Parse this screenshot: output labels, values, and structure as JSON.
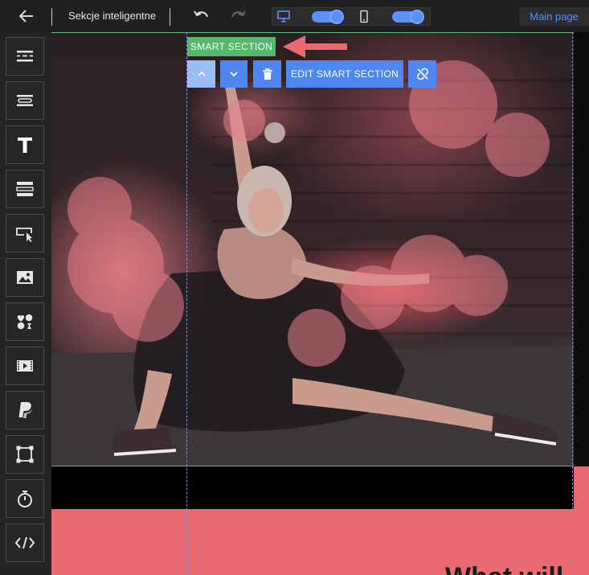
{
  "header": {
    "title": "Sekcje inteligentne",
    "main_page_label": "Main page",
    "icons": [
      "back-arrow-icon",
      "undo-icon",
      "redo-icon",
      "desktop-icon",
      "mobile-icon"
    ]
  },
  "sidebar": {
    "items": [
      {
        "name": "section-layout-icon"
      },
      {
        "name": "smart-section-icon"
      },
      {
        "name": "text-icon",
        "glyph": "T"
      },
      {
        "name": "rows-icon"
      },
      {
        "name": "button-cursor-icon"
      },
      {
        "name": "image-icon"
      },
      {
        "name": "emoji-icons-icon"
      },
      {
        "name": "video-icon"
      },
      {
        "name": "paypal-icon",
        "glyph": "P"
      },
      {
        "name": "shape-icon"
      },
      {
        "name": "timer-icon"
      },
      {
        "name": "code-icon",
        "glyph": "</>"
      }
    ]
  },
  "section_toolbar": {
    "badge_label": "SMART SECTION",
    "edit_label": "EDIT SMART SECTION",
    "icons": [
      "move-up-icon",
      "move-down-icon",
      "trash-icon",
      "unlink-icon"
    ]
  },
  "canvas": {
    "pink_heading": "What will"
  },
  "colors": {
    "accent": "#4f86f2",
    "badge": "#55b86c",
    "arrow": "#e96a71",
    "pink_section": "#e96a71",
    "topbar": "#202020",
    "sidebar": "#232323"
  }
}
